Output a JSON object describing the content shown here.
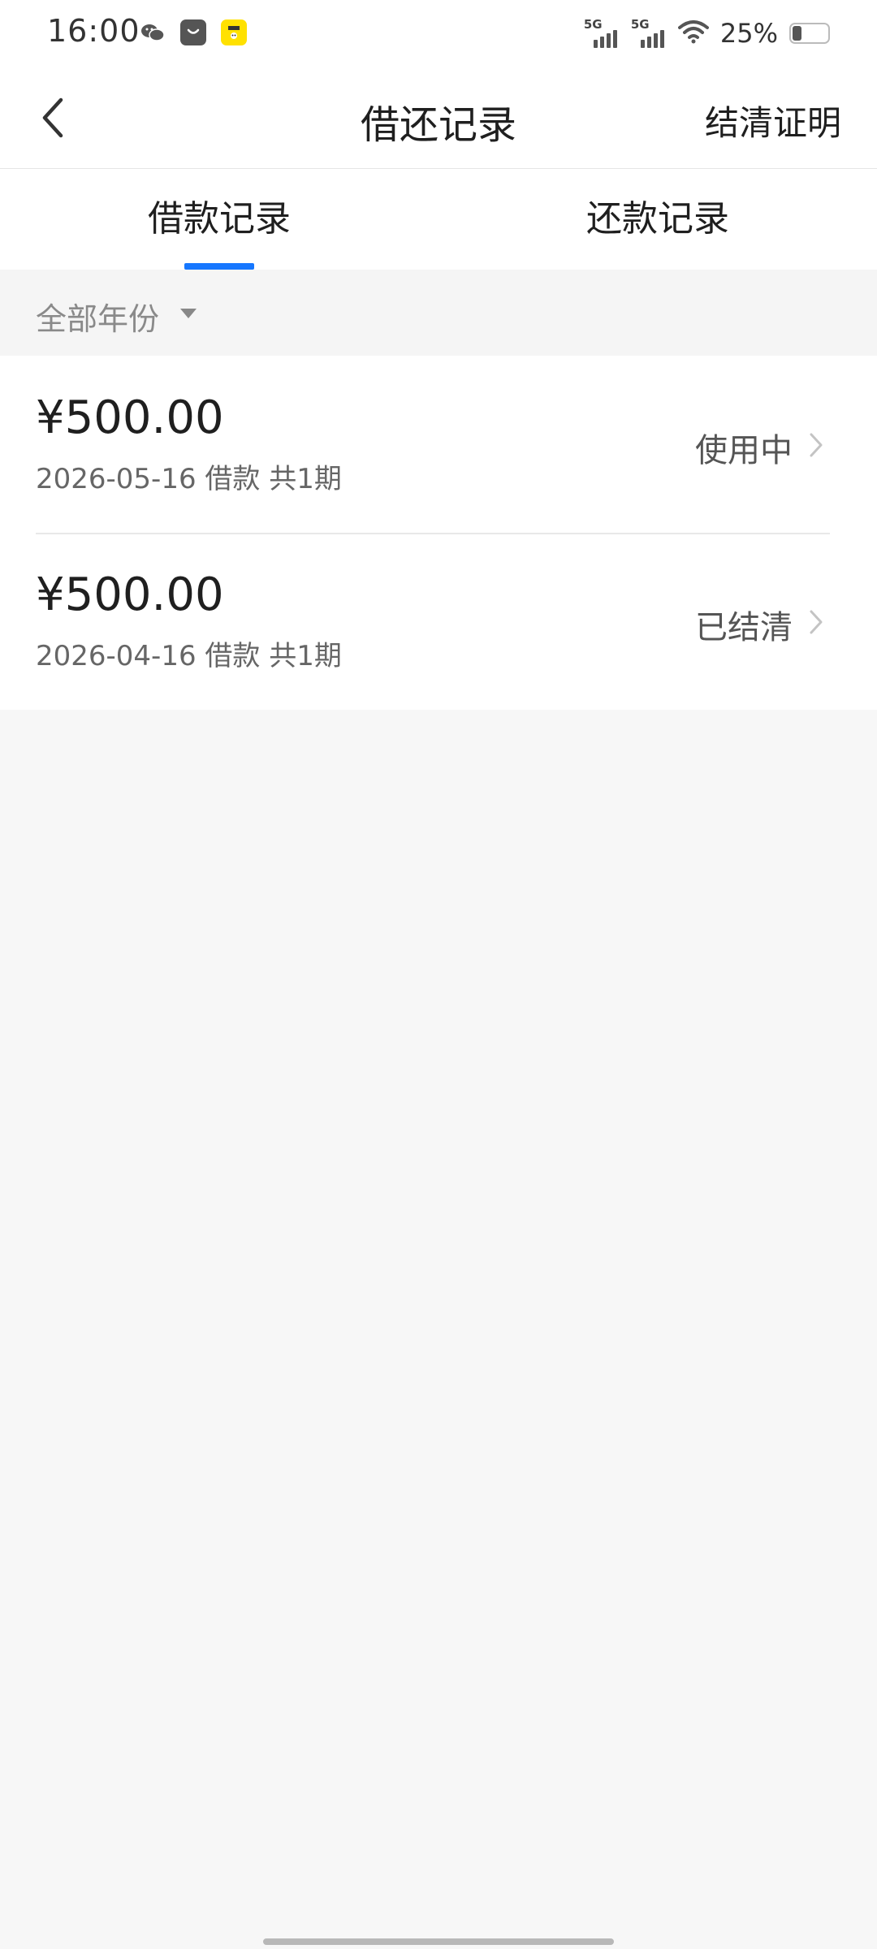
{
  "status_bar": {
    "time": "16:00",
    "app_icons": [
      "wechat-icon",
      "shopping-bag-icon",
      "yellow-app-icon"
    ],
    "signal_1_label": "5G",
    "signal_2_label": "5G",
    "battery_percent": "25%",
    "battery_level": 0.25
  },
  "header": {
    "title": "借还记录",
    "action_label": "结清证明"
  },
  "tabs": [
    {
      "label": "借款记录",
      "selected": true
    },
    {
      "label": "还款记录",
      "selected": false
    }
  ],
  "accent_color": "#1677ff",
  "filter": {
    "label": "全部年份"
  },
  "records": [
    {
      "amount": "¥500.00",
      "meta": "2026-05-16 借款 共1期",
      "status": "使用中"
    },
    {
      "amount": "¥500.00",
      "meta": "2026-04-16 借款 共1期",
      "status": "已结清"
    }
  ]
}
